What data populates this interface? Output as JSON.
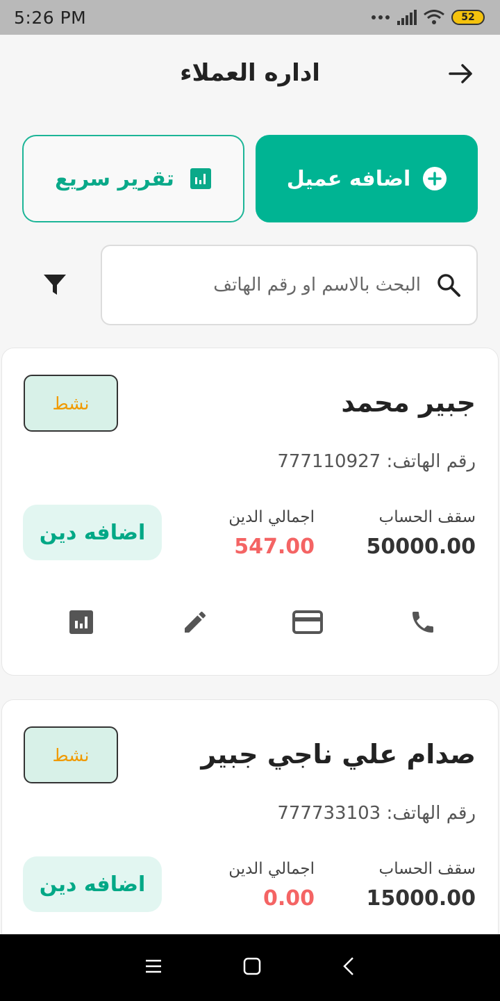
{
  "status_bar": {
    "time": "5:26 PM",
    "battery": "52"
  },
  "header": {
    "title": "اداره العملاء"
  },
  "actions": {
    "add_customer": "اضافه عميل",
    "quick_report": "تقرير سريع"
  },
  "search": {
    "placeholder": "البحث بالاسم او رقم الهاتف"
  },
  "customers": [
    {
      "status": "نشط",
      "name": "جبير محمد",
      "phone_label": "رقم الهاتف:",
      "phone": "777110927",
      "limit_label": "سقف الحساب",
      "limit": "50000.00",
      "debt_label": "اجمالي الدين",
      "debt": "547.00",
      "add_debt": "اضافه دين"
    },
    {
      "status": "نشط",
      "name": "صدام علي ناجي جبير",
      "phone_label": "رقم الهاتف:",
      "phone": "777733103",
      "limit_label": "سقف الحساب",
      "limit": "15000.00",
      "debt_label": "اجمالي الدين",
      "debt": "0.00",
      "add_debt": "اضافه دين"
    }
  ],
  "colors": {
    "primary": "#00b493",
    "debt": "#f46464",
    "status": "#f09a00"
  }
}
